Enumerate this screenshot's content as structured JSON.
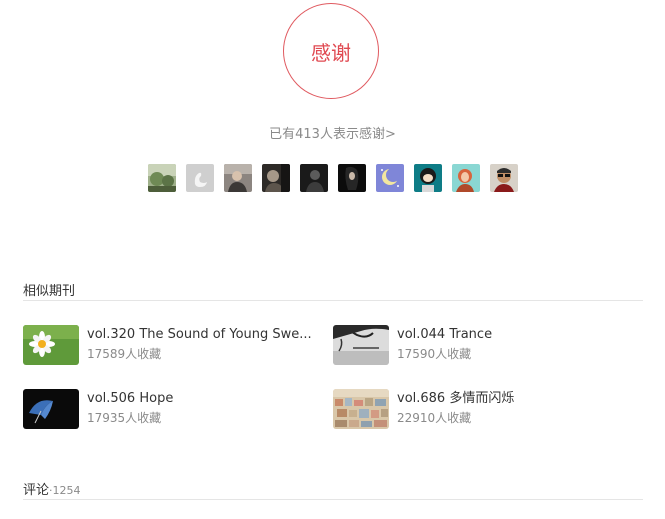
{
  "thanks": {
    "button_label": "感谢",
    "count_text": "已有413人表示感谢>",
    "accent_color": "#e04a52"
  },
  "avatars": [
    "user-avatar-nature",
    "user-avatar-swan",
    "user-avatar-portrait",
    "user-avatar-dark-portrait",
    "user-avatar-silhouette",
    "user-avatar-black-hair",
    "user-avatar-moon",
    "user-avatar-cartoon",
    "user-avatar-illustration",
    "user-avatar-sunglasses"
  ],
  "similar": {
    "title": "相似期刊",
    "items": [
      {
        "title": "vol.320 The Sound of Young Swe...",
        "fav": "17589人收藏",
        "thumb": "daisy-thumbnail"
      },
      {
        "title": "vol.044 Trance",
        "fav": "17590人收藏",
        "thumb": "tree-branch-thumbnail"
      },
      {
        "title": "vol.506 Hope",
        "fav": "17935人收藏",
        "thumb": "umbrella-thumbnail"
      },
      {
        "title": "vol.686 多情而闪烁",
        "fav": "22910人收藏",
        "thumb": "town-thumbnail"
      }
    ]
  },
  "comments": {
    "title": "评论",
    "count": "·1254"
  }
}
